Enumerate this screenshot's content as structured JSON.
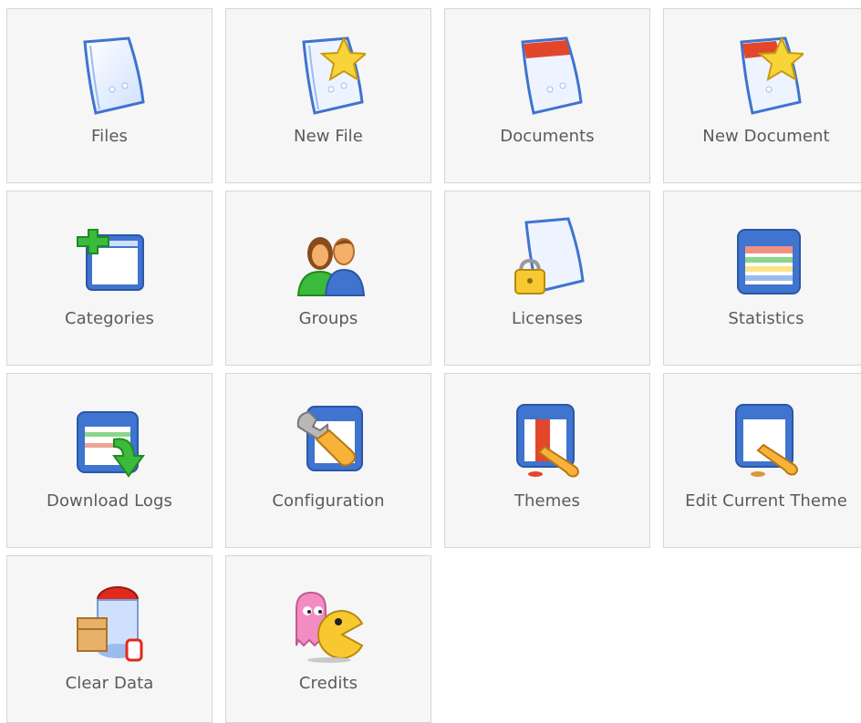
{
  "tiles": [
    {
      "label": "Files",
      "icon": "file-icon"
    },
    {
      "label": "New File",
      "icon": "new-file-icon"
    },
    {
      "label": "Documents",
      "icon": "document-icon"
    },
    {
      "label": "New Document",
      "icon": "new-document-icon"
    },
    {
      "label": "Categories",
      "icon": "categories-icon"
    },
    {
      "label": "Groups",
      "icon": "groups-icon"
    },
    {
      "label": "Licenses",
      "icon": "license-icon"
    },
    {
      "label": "Statistics",
      "icon": "statistics-icon"
    },
    {
      "label": "Download Logs",
      "icon": "download-logs-icon"
    },
    {
      "label": "Configuration",
      "icon": "configuration-icon"
    },
    {
      "label": "Themes",
      "icon": "themes-icon"
    },
    {
      "label": "Edit Current Theme",
      "icon": "edit-theme-icon"
    },
    {
      "label": "Clear Data",
      "icon": "clear-data-icon"
    },
    {
      "label": "Credits",
      "icon": "credits-icon"
    }
  ],
  "colors": {
    "tile_bg": "#f6f6f6",
    "tile_border": "#d6d6d6",
    "label": "#5a5a5a",
    "icon_blue": "#3f74cf",
    "star_yellow": "#f7d43a",
    "doc_red": "#e2472b"
  }
}
